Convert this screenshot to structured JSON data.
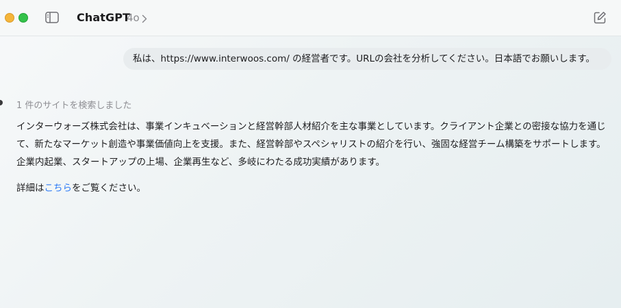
{
  "header": {
    "app_title": "ChatGPT",
    "model": "4o"
  },
  "conversation": {
    "user_message": "私は、https://www.interwoos.com/ の経営者です。URLの会社を分析してください。日本語でお願いします。",
    "search_status": "1 件のサイトを検索しました",
    "answer_paragraph": "インターウォーズ株式会社は、事業インキュベーションと経営幹部人材紹介を主な事業としています。クライアント企業との密接な協力を通じて、新たなマーケット創造や事業価値向上を支援。また、経営幹部やスペシャリストの紹介を行い、強固な経営チーム構築をサポートします。企業内起業、スタートアップの上場、企業再生など、多岐にわたる成功実績があります。",
    "details_prefix": "詳細は",
    "details_link": "こちら",
    "details_suffix": "をご覧ください。"
  },
  "colors": {
    "link": "#2f7cf6",
    "traffic_yellow": "#f5b53a",
    "traffic_green": "#34c24a"
  },
  "icons": {
    "sidebar": "sidebar-toggle-icon",
    "chevron": "chevron-right-icon",
    "compose": "new-chat-icon"
  }
}
